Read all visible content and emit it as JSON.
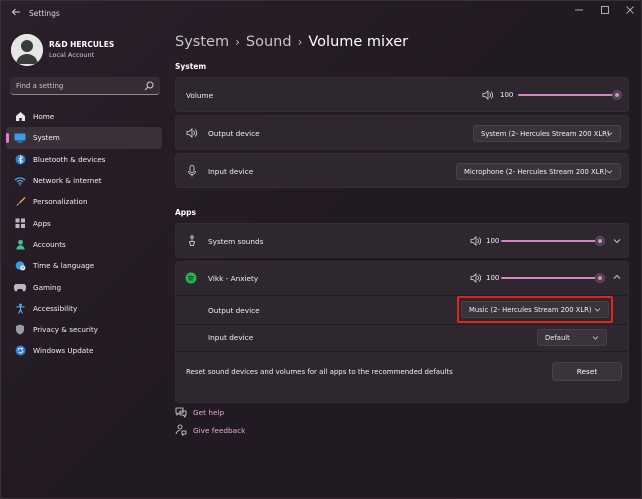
{
  "window": {
    "title": "Settings"
  },
  "user": {
    "name": "R&D HERCULES",
    "account": "Local Account"
  },
  "search": {
    "placeholder": "Find a setting"
  },
  "sidebar": {
    "items": [
      {
        "label": "Home",
        "icon": "home-icon"
      },
      {
        "label": "System",
        "icon": "system-icon",
        "active": true
      },
      {
        "label": "Bluetooth & devices",
        "icon": "bluetooth-icon"
      },
      {
        "label": "Network & internet",
        "icon": "wifi-icon"
      },
      {
        "label": "Personalization",
        "icon": "brush-icon"
      },
      {
        "label": "Apps",
        "icon": "apps-icon"
      },
      {
        "label": "Accounts",
        "icon": "person-icon"
      },
      {
        "label": "Time & language",
        "icon": "globe-clock-icon"
      },
      {
        "label": "Gaming",
        "icon": "gamepad-icon"
      },
      {
        "label": "Accessibility",
        "icon": "accessibility-icon"
      },
      {
        "label": "Privacy & security",
        "icon": "shield-icon"
      },
      {
        "label": "Windows Update",
        "icon": "update-icon"
      }
    ]
  },
  "breadcrumb": {
    "level1": "System",
    "level2": "Sound",
    "current": "Volume mixer"
  },
  "system_section": {
    "heading": "System",
    "volume": {
      "label": "Volume",
      "value": "100",
      "level": 1.0
    },
    "output": {
      "label": "Output device",
      "selected": "System (2- Hercules Stream 200 XLR)"
    },
    "input": {
      "label": "Input device",
      "selected": "Microphone (2- Hercules Stream 200 XLR)"
    }
  },
  "apps_section": {
    "heading": "Apps",
    "system_sounds": {
      "label": "System sounds",
      "value": "100",
      "level": 1.0
    },
    "vikk": {
      "label": "Vikk - Anxiety",
      "value": "100",
      "level": 1.0,
      "output": {
        "label": "Output device",
        "selected": "Music (2- Hercules Stream 200 XLR)"
      },
      "input": {
        "label": "Input device",
        "selected": "Default"
      }
    },
    "reset": {
      "label": "Reset sound devices and volumes for all apps to the recommended defaults",
      "button": "Reset"
    }
  },
  "links": {
    "help": "Get help",
    "feedback": "Give feedback"
  },
  "colors": {
    "accent": "#e08bd0",
    "highlight": "#e0251b",
    "spotify": "#1db954"
  }
}
